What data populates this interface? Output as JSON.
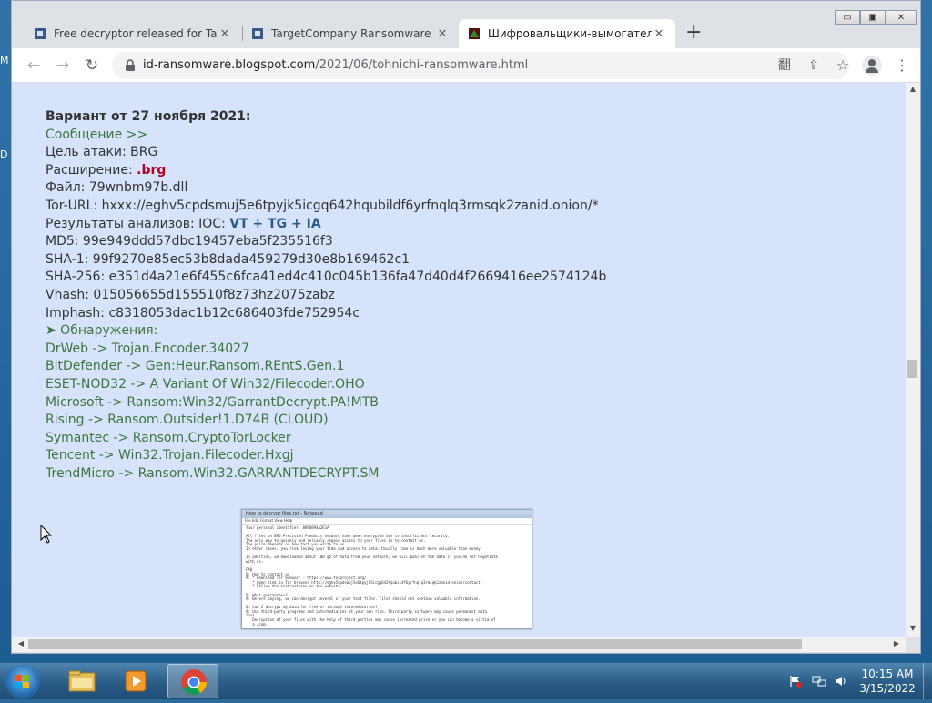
{
  "desktop": {
    "side_letters": [
      "M",
      "D"
    ]
  },
  "browser": {
    "tabs": [
      {
        "title": "Free decryptor released for Targe",
        "close": "✕"
      },
      {
        "title": "TargetCompany Ransomware Sup",
        "close": "✕"
      },
      {
        "title": "Шифровальщики-вымогатели Т",
        "close": "✕"
      }
    ],
    "new_tab": "+",
    "window_controls": {
      "minimize": "▭",
      "maximize": "▣",
      "close": "✕"
    },
    "nav": {
      "back": "←",
      "forward": "→",
      "reload": "↻"
    },
    "url_domain": "id-ransomware.blogspot.com",
    "url_path": "/2021/06/tohnichi-ransomware.html",
    "omnibox_icons": {
      "translate": "翻",
      "share": "⇪",
      "bookmark": "☆"
    },
    "menu": "⋮"
  },
  "article": {
    "heading": "Вариант от 27 ноября 2021:",
    "message_link": "Сообщение >>",
    "target_label": "Цель атаки:",
    "target_value": "BRG",
    "extension_label": "Расширение:",
    "extension_value": ".brg",
    "file_label": "Файл:",
    "file_value": "79wnbm97b.dll",
    "tor_label": "Tor-URL:",
    "tor_value": "hxxx://eghv5cpdsmuj5e6tpyjk5icgq642hqubildf6yrfnqlq3rmsqk2zanid.onion/*",
    "analysis_label": "Результаты анализов: IOC:",
    "analysis_links": "VT + TG + IA",
    "hashes": [
      "MD5: 99e949ddd57dbc19457eba5f235516f3",
      "SHA-1: 99f9270e85ec53b8dada459279d30e8b169462c1",
      "SHA-256: e351d4a21e6f455c6fca41ed4c410c045b136fa47d40d4f2669416ee2574124b",
      "Vhash: 015056655d155510f8z73hz2075zabz",
      "Imphash: c8318053dac1b12c686403fde752954c"
    ],
    "detections_header": "➤ Обнаружения:",
    "detections": [
      "DrWeb -> Trojan.Encoder.34027",
      "BitDefender -> Gen:Heur.Ransom.REntS.Gen.1",
      "ESET-NOD32 -> A Variant Of Win32/Filecoder.OHO",
      "Microsoft -> Ransom:Win32/GarrantDecrypt.PA!MTB",
      "Rising -> Ransom.Outsider!1.D74B (CLOUD)",
      "Symantec -> Ransom.CryptoTorLocker",
      "Tencent -> Win32.Trojan.Filecoder.Hxgj",
      "TrendMicro -> Ransom.Win32.GARRANTDECRYPT.SM"
    ],
    "thumbnail": {
      "title": "How to decrypt files.txt - Notepad",
      "menu": "File  Edit  Format  View  Help",
      "text": "Your personal identifier: 8890894A2E1A\n\nAll files on BRG Precision Products network have been encrypted due to insufficient security.\nThe only way to quickly and reliably regain access to your files is to contact us.\nThe price depends on how fast you write to us.\nIn other cases, you risk losing your time and access to data. Usually time is much more valuable than money.\n\nIn addition, we downloaded about 100 gb of data from your network, we will publish the data if you do not negotiate\nwith us.\n\nFAQ\nQ: How to contact us\nA: * Download Tor browser - https://www.torproject.org/\n   * Open link in Tor browser http://eghv5cpdsmuj5e6tpyjk5icgq642hqubildf6yrfnqlq3rmsqk2zanid.onion/contact\n   * Follow the instructions on the website.\n\nQ: What guarantees?\nA: Before paying, we can decrypt several of your test files. Files should not contain valuable information.\n\nQ: Can I decrypt my data for free or through intermediaries?\nA: Use third-party programs and intermediaries at your own risk. Third-party software may cause permanent data\nloss.\n   Decryption of your files with the help of third parties may cause increased price or you can become a victim of\n   a scam."
    }
  },
  "taskbar": {
    "clock_time": "10:15 AM",
    "clock_date": "3/15/2022"
  }
}
